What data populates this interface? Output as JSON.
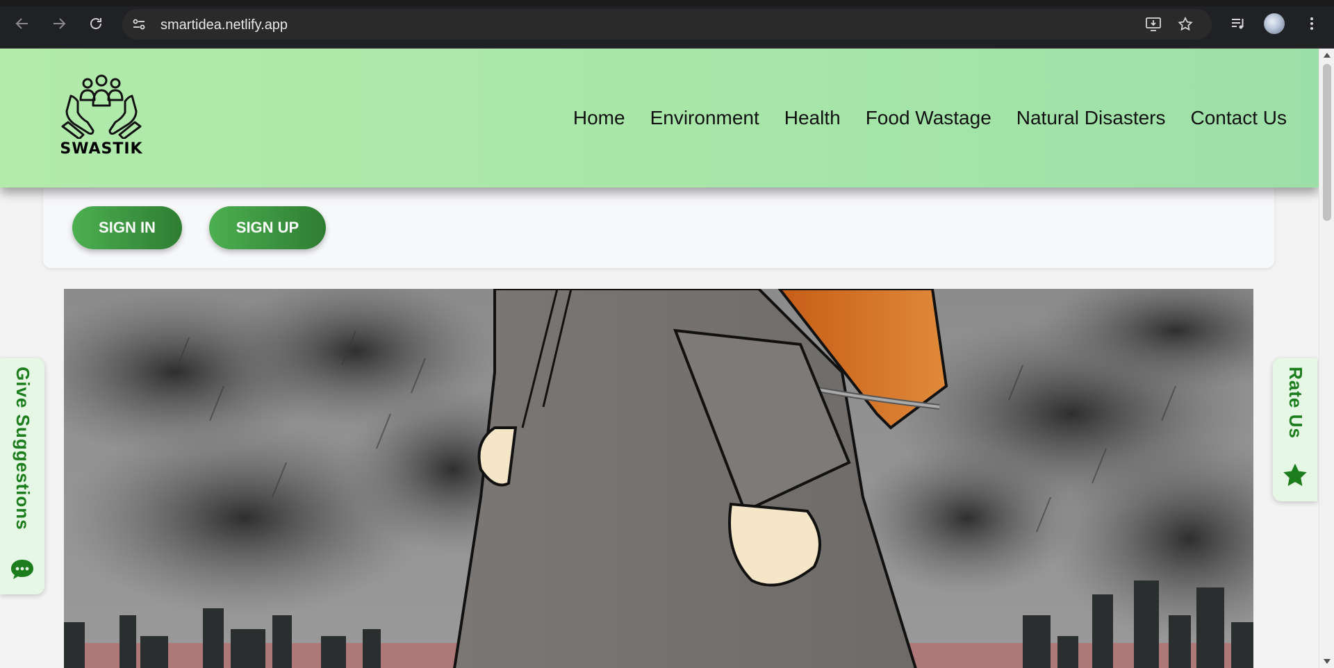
{
  "browser": {
    "url": "smartidea.netlify.app"
  },
  "header": {
    "brand": "SWASTIK",
    "nav": [
      "Home",
      "Environment",
      "Health",
      "Food Wastage",
      "Natural Disasters",
      "Contact Us"
    ]
  },
  "auth": {
    "sign_in": "SIGN IN",
    "sign_up": "SIGN UP"
  },
  "side_tabs": {
    "suggestions": "Give Suggestions",
    "rate": "Rate Us"
  },
  "colors": {
    "header_bg": "#b2ebaa",
    "button_green": "#2e7d32",
    "tab_text": "#1b7d1b"
  },
  "icons": [
    "back-arrow-icon",
    "forward-arrow-icon",
    "reload-icon",
    "site-info-icon",
    "install-app-icon",
    "bookmark-star-icon",
    "media-queue-icon",
    "profile-avatar",
    "menu-dots-icon",
    "logo-hands-people-icon",
    "chat-bubble-icon",
    "star-icon"
  ]
}
